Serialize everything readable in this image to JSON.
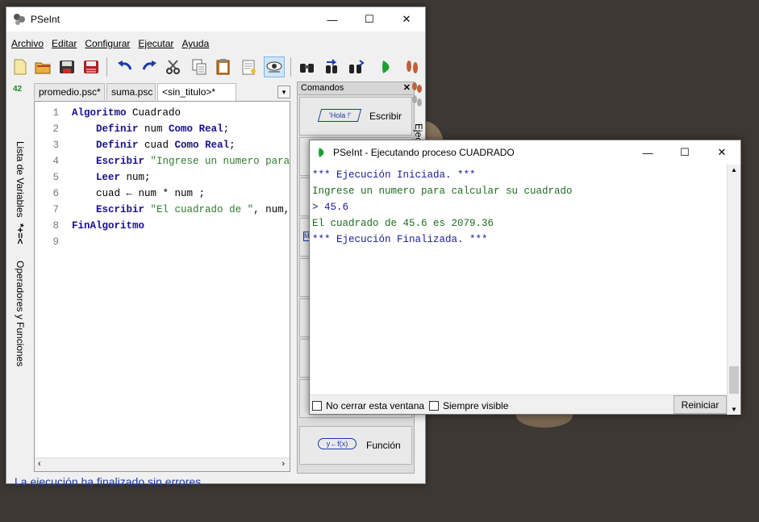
{
  "main_window": {
    "title": "PSeInt",
    "controls": {
      "minimize": "—",
      "maximize": "☐",
      "close": "✕"
    }
  },
  "menu": [
    "Archivo",
    "Editar",
    "Configurar",
    "Ejecutar",
    "Ayuda"
  ],
  "toolbar_icons": [
    "new-file-icon",
    "open-file-icon",
    "save-icon",
    "save-as-icon",
    "undo-icon",
    "redo-icon",
    "cut-icon",
    "copy-icon",
    "paste-icon",
    "find-icon",
    "step-by-step-icon",
    "search-icon",
    "find-next-icon",
    "replace-icon",
    "run-icon",
    "step-icon"
  ],
  "side_panel": {
    "variables_label": "Lista de Variables",
    "variables_glyph": "42",
    "operators_label": "Operadores y Funciones",
    "operators_glyph": "*+=<"
  },
  "tabs": [
    "promedio.psc*",
    "suma.psc",
    "<sin_titulo>*"
  ],
  "code_lines": [
    {
      "n": "1",
      "parts": [
        [
          "kw",
          "Algoritmo"
        ],
        [
          "plain",
          " Cuadrado"
        ]
      ]
    },
    {
      "n": "2",
      "parts": [
        [
          "plain",
          "    "
        ],
        [
          "kw",
          "Definir"
        ],
        [
          "plain",
          " num "
        ],
        [
          "kw",
          "Como"
        ],
        [
          "plain",
          " "
        ],
        [
          "kw",
          "Real"
        ],
        [
          "plain",
          ";"
        ]
      ]
    },
    {
      "n": "3",
      "parts": [
        [
          "plain",
          "    "
        ],
        [
          "kw",
          "Definir"
        ],
        [
          "plain",
          " cuad "
        ],
        [
          "kw",
          "Como"
        ],
        [
          "plain",
          " "
        ],
        [
          "kw",
          "Real"
        ],
        [
          "plain",
          ";"
        ]
      ]
    },
    {
      "n": "4",
      "parts": [
        [
          "plain",
          "    "
        ],
        [
          "kw",
          "Escribir"
        ],
        [
          "plain",
          " "
        ],
        [
          "str",
          "\"Ingrese un numero para"
        ]
      ]
    },
    {
      "n": "5",
      "parts": [
        [
          "plain",
          "    "
        ],
        [
          "kw",
          "Leer"
        ],
        [
          "plain",
          " num;"
        ]
      ]
    },
    {
      "n": "6",
      "parts": [
        [
          "plain",
          "    cuad ← num * num ;"
        ]
      ]
    },
    {
      "n": "7",
      "parts": [
        [
          "plain",
          "    "
        ],
        [
          "kw",
          "Escribir"
        ],
        [
          "plain",
          " "
        ],
        [
          "str",
          "\"El cuadrado de \""
        ],
        [
          "plain",
          ", num,"
        ]
      ]
    },
    {
      "n": "8",
      "parts": [
        [
          "kw",
          "FinAlgoritmo"
        ]
      ]
    },
    {
      "n": "9",
      "parts": []
    }
  ],
  "commands_panel": {
    "title": "Comandos",
    "close": "✕",
    "escribir_label": "Escribir",
    "escribir_glyph": "'Hola !'",
    "funcion_label": "Función",
    "funcion_glyph": "y←f(x)",
    "side_tab": "Ejecu"
  },
  "status": "La ejecución ha finalizado sin errores.",
  "run_window": {
    "title": "PSeInt - Ejecutando proceso CUADRADO",
    "controls": {
      "minimize": "—",
      "maximize": "☐",
      "close": "✕"
    },
    "output": [
      {
        "color": "blue",
        "text": "*** Ejecución Iniciada. ***"
      },
      {
        "color": "green",
        "text": "Ingrese un numero para calcular su cuadrado"
      },
      {
        "color": "blue",
        "text": "> 45.6"
      },
      {
        "color": "green",
        "text": "El cuadrado de 45.6 es 2079.36"
      },
      {
        "color": "blue",
        "text": "*** Ejecución Finalizada. ***"
      }
    ],
    "no_cerrar": "No cerrar esta ventana",
    "siempre_visible": "Siempre visible",
    "reiniciar": "Reiniciar"
  },
  "colors": {
    "keyword": "#1a0f8f",
    "string": "#2c7a2c",
    "status": "#1a3aa8",
    "desktop": "#3e3834"
  }
}
